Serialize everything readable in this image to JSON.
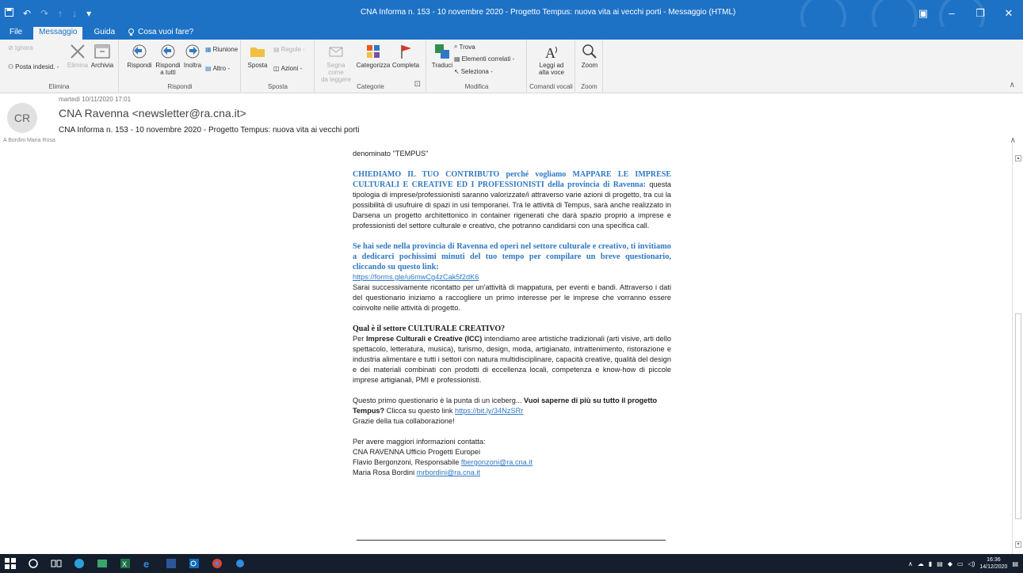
{
  "window": {
    "title": "CNA Informa n. 153 - 10 novembre 2020 - Progetto Tempus: nuova vita ai vecchi porti  -  Messaggio (HTML)"
  },
  "menu": {
    "file": "File",
    "messaggio": "Messaggio",
    "guida": "Guida",
    "search": "Cosa vuoi fare?"
  },
  "ribbon": {
    "elimina": {
      "label": "Elimina",
      "ignora": "Ignora",
      "posta_indesid": "Posta indesid. -",
      "elimina_btn": "Elimina",
      "archivia": "Archivia"
    },
    "rispondi": {
      "label": "Rispondi",
      "rispondi": "Rispondi",
      "rispondi_tutti_1": "Rispondi",
      "rispondi_tutti_2": "a tutti",
      "inoltra": "Inoltra",
      "riunione": "Riunione",
      "altro": "Altro -"
    },
    "sposta": {
      "label": "Sposta",
      "regole": "Regole -",
      "sposta": "Sposta",
      "azioni": "Azioni -"
    },
    "categorie": {
      "label": "Categorie",
      "segna_1": "Segna come",
      "segna_2": "da leggere",
      "categorizza": "Categorizza",
      "completa": "Completa"
    },
    "modifica": {
      "label": "Modifica",
      "traduci": "Traduci",
      "trova": "Trova",
      "elementi": "Elementi correlati -",
      "seleziona": "Seleziona -"
    },
    "comandi_vocali": {
      "label": "Comandi vocali",
      "leggi_1": "Leggi ad",
      "leggi_2": "alta voce"
    },
    "zoom": {
      "label": "Zoom",
      "zoom": "Zoom"
    }
  },
  "header": {
    "avatar": "CR",
    "date": "martedì 10/11/2020 17:01",
    "sender": "CNA Ravenna <newsletter@ra.cna.it>",
    "subject": "CNA Informa n. 153 - 10 novembre 2020 - Progetto Tempus: nuova vita ai vecchi porti",
    "to": "A  Bordini Maria Rosa"
  },
  "body": {
    "p0": "denominato \"TEMPUS\"",
    "p1_bold": "CHIEDIAMO IL TUO CONTRIBUTO perché vogliamo MAPPARE LE IMPRESE CULTURALI E CREATIVE ED I PROFESSIONISTI della provincia di Ravenna:",
    "p1_text": " questa tipologia di imprese/professionisti saranno valorizzate/i attraverso varie azioni di progetto, tra cui la possibilità di usufruire di spazi in usi temporanei. Tra le attività di Tempus, sarà anche realizzato in Darsena un progetto architettonico in container rigenerati che darà spazio proprio a imprese e professionisti del settore culturale e creativo, che potranno candidarsi con una specifica call.",
    "p2_bold": "Se hai sede nella provincia di Ravenna ed operi nel settore culturale e creativo, ti invitiamo a dedicarci pochissimi minuti del tuo tempo per compilare un breve questionario, cliccando su questo link:",
    "p2_link": "https://forms.gle/u6mwCg4zCak5f2dK6",
    "p2_text": "Sarai successivamente ricontatto per un'attività di mappatura, per eventi e bandi. Attraverso i dati del questionario iniziamo a raccogliere un primo interesse per le imprese che vorranno essere coinvolte nelle attività di progetto.",
    "p3_title": "Qual è il settore CULTURALE CREATIVO?",
    "p3_pre": "Per ",
    "p3_bold": "Imprese Culturali e Creative (ICC)",
    "p3_text": " intendiamo aree artistiche tradizionali (arti visive, arti dello spettacolo, letteratura, musica), turismo, design, moda, artigianato, intrattenimento, ristorazione e industria alimentare e tutti i settori con natura multidisciplinare, capacità creative, qualità del design e dei materiali combinati con prodotti di eccellenza locali, competenza e know-how di piccole imprese artigianali, PMI e professionisti.",
    "p4_pre": "Questo primo questionario è la punta di un iceberg... ",
    "p4_bold": "Vuoi saperne di più su tutto il progetto Tempus?",
    "p4_mid": " Clicca su questo link ",
    "p4_link": "https://bit.ly/34NzSRr",
    "p4_thanks": "Grazie della tua collaborazione!",
    "c1": "Per avere maggiori informazioni contatta:",
    "c2": "CNA RAVENNA Ufficio Progetti Europei",
    "c3_pre": "Flavio Bergonzoni, Responsabile ",
    "c3_link": "fbergonzoni@ra.cna.it",
    "c4_pre": "Maria Rosa Bordini ",
    "c4_link": "mrbordini@ra.cna.it"
  },
  "taskbar": {
    "time": "16:36",
    "date": "14/12/2020"
  },
  "colors": {
    "titlebar": "#1d72c6",
    "link": "#2f78c4",
    "taskbar": "#151e2c"
  }
}
